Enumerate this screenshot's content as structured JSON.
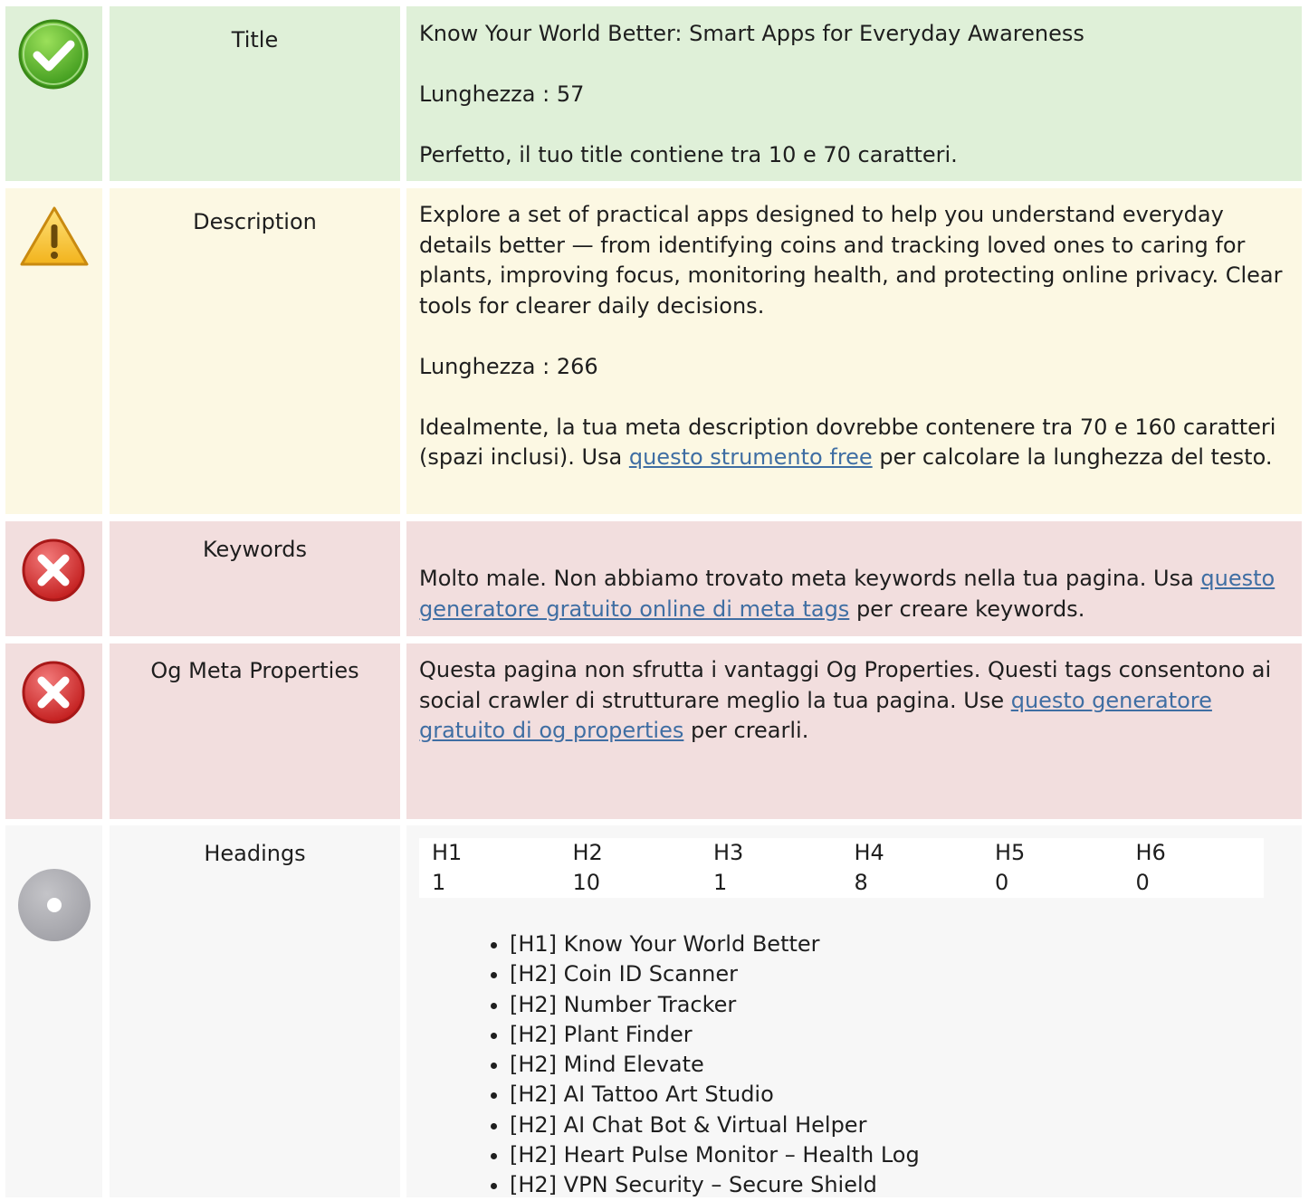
{
  "colors": {
    "success_bg": "#dff0d8",
    "warning_bg": "#fcf8e3",
    "error_bg": "#f2dede",
    "info_bg": "#f7f7f7",
    "link": "#3f6ea3"
  },
  "rows": {
    "title": {
      "status_icon": "check-circle-icon",
      "label": "Title",
      "value": "Know Your World Better: Smart Apps for Everyday Awareness",
      "length": "Lunghezza : 57",
      "message": "Perfetto, il tuo title contiene tra 10 e 70 caratteri."
    },
    "description": {
      "status_icon": "warning-triangle-icon",
      "label": "Description",
      "value": "Explore a set of practical apps designed to help you understand everyday details better — from identifying coins and tracking loved ones to caring for plants, improving focus, monitoring health, and protecting online privacy. Clear tools for clearer daily decisions.",
      "length": "Lunghezza : 266",
      "message_before": "Idealmente, la tua meta description dovrebbe contenere tra 70 e 160 caratteri (spazi inclusi). Usa ",
      "link_text": "questo strumento free",
      "message_after": " per calcolare la lunghezza del testo."
    },
    "keywords": {
      "status_icon": "error-x-circle-icon",
      "label": "Keywords",
      "message_before": "Molto male. Non abbiamo trovato meta keywords nella tua pagina. Usa ",
      "link_text": "questo generatore gratuito online di meta tags",
      "message_after": " per creare keywords."
    },
    "og": {
      "status_icon": "error-x-circle-icon",
      "label": "Og Meta Properties",
      "message_before": "Questa pagina non sfrutta i vantaggi Og Properties. Questi tags consentono ai social crawler di strutturare meglio la tua pagina. Use ",
      "link_text": "questo generatore gratuito di og properties",
      "message_after": " per crearli."
    },
    "headings": {
      "status_icon": "info-dot-circle-icon",
      "label": "Headings",
      "columns": [
        "H1",
        "H2",
        "H3",
        "H4",
        "H5",
        "H6"
      ],
      "counts": [
        "1",
        "10",
        "1",
        "8",
        "0",
        "0"
      ],
      "items": [
        "[H1] Know Your World Better",
        "[H2] Coin ID Scanner",
        "[H2] Number Tracker",
        "[H2] Plant Finder",
        "[H2] Mind Elevate",
        "[H2] AI Tattoo Art Studio",
        "[H2] AI Chat Bot & Virtual Helper",
        "[H2] Heart Pulse Monitor – Health Log",
        "[H2] VPN Security – Secure Shield"
      ]
    }
  }
}
